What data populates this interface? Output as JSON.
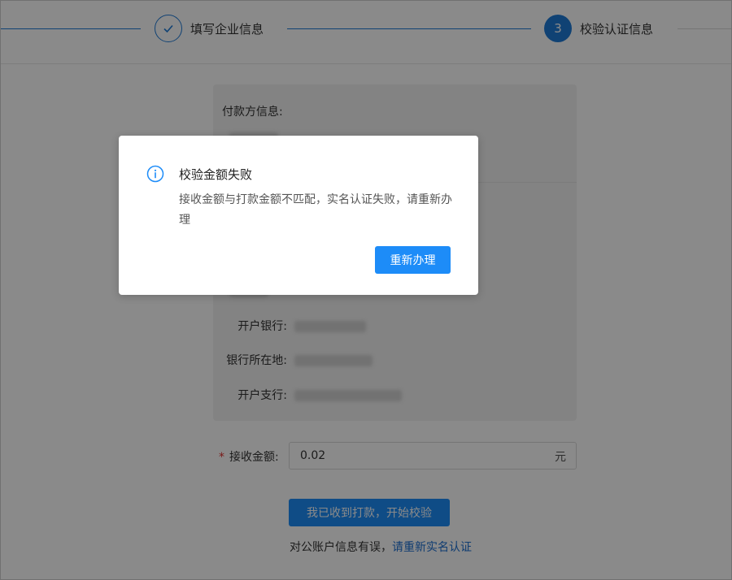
{
  "steps": {
    "step2_label": "填写企业信息",
    "step3_number": "3",
    "step3_label": "校验认证信息"
  },
  "panel": {
    "title": "付款方信息:",
    "rows": [
      {
        "label": "开户银行:"
      },
      {
        "label": "银行所在地:"
      },
      {
        "label": "开户支行:"
      }
    ]
  },
  "amount": {
    "required_mark": "*",
    "label": "接收金额:",
    "value": "0.02",
    "unit": "元"
  },
  "start_button": "我已收到打款，开始校验",
  "footer": {
    "text": "对公账户信息有误，",
    "link": "请重新实名认证"
  },
  "modal": {
    "title": "校验金额失败",
    "message": "接收金额与打款金额不匹配，实名认证失败，请重新办理",
    "button": "重新办理"
  },
  "colors": {
    "accent": "#1d8cf8",
    "step_blue": "#1f7ad6",
    "required": "#e0302e"
  }
}
